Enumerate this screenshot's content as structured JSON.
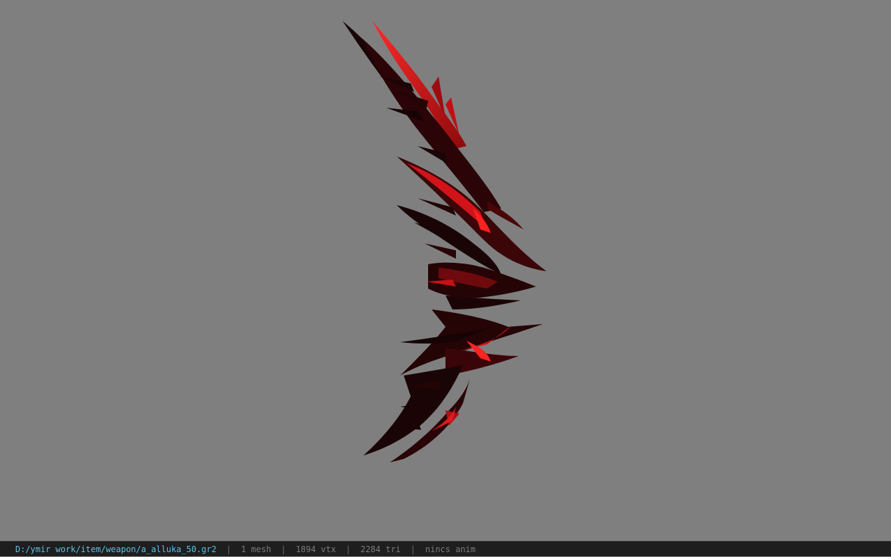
{
  "viewer": {
    "background_color": "#7f7f7f",
    "model_colors": {
      "dark": "#1a0506",
      "mid": "#5a0a0c",
      "bright": "#d8141a"
    }
  },
  "statusbar": {
    "path": "D:/ymir work/item/weapon/a_alluka_50.gr2",
    "separator": "|",
    "mesh": "1 mesh",
    "vtx": "1894 vtx",
    "tri": "2284 tri",
    "anim": "nincs anim",
    "path_color": "#5cc2e8",
    "background": "#1e1e1e"
  }
}
